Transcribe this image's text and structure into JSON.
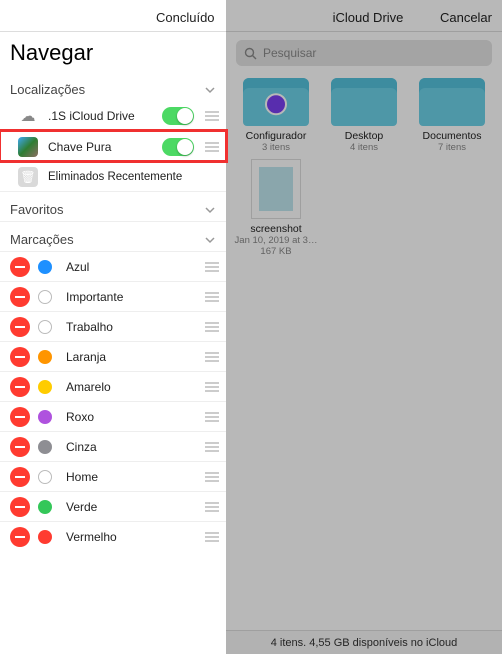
{
  "header": {
    "done": "Concluído",
    "title": "iCloud Drive",
    "cancel": "Cancelar"
  },
  "sidebar": {
    "browse_title": "Navegar",
    "sections": {
      "locations_label": "Localizações",
      "favorites_label": "Favoritos",
      "tags_label": "Marcações"
    },
    "locations": [
      {
        "label": ".1S iCloud Drive",
        "icon": "cloud",
        "toggle": true
      },
      {
        "label": "Chave Pura",
        "icon": "app",
        "toggle": true
      },
      {
        "label": "Eliminados Recentemente",
        "icon": "trash",
        "toggle": false
      }
    ],
    "tags": [
      {
        "label": "Azul",
        "color": "#1e90ff",
        "outline": false
      },
      {
        "label": "Importante",
        "color": "#bbb",
        "outline": true
      },
      {
        "label": "Trabalho",
        "color": "#bbb",
        "outline": true
      },
      {
        "label": "Laranja",
        "color": "#ff9500",
        "outline": false
      },
      {
        "label": "Amarelo",
        "color": "#ffcc00",
        "outline": false
      },
      {
        "label": "Roxo",
        "color": "#af52de",
        "outline": false
      },
      {
        "label": "Cinza",
        "color": "#8e8e93",
        "outline": false
      },
      {
        "label": "Home",
        "color": "#bbb",
        "outline": true
      },
      {
        "label": "Verde",
        "color": "#34c759",
        "outline": false
      },
      {
        "label": "Vermelho",
        "color": "#ff3b30",
        "outline": false
      }
    ]
  },
  "search": {
    "placeholder": "Pesquisar"
  },
  "folders": [
    {
      "name": "Configurador",
      "sub": "3 itens",
      "badge": "purple"
    },
    {
      "name": "Desktop",
      "sub": "4 itens",
      "badge": null
    },
    {
      "name": "Documentos",
      "sub": "7 itens",
      "badge": null
    }
  ],
  "files": [
    {
      "name": "screenshot",
      "sub1": "Jan 10, 2019 at 3…",
      "sub2": "167 KB"
    }
  ],
  "footer": "4 itens. 4,55 GB disponíveis no iCloud"
}
